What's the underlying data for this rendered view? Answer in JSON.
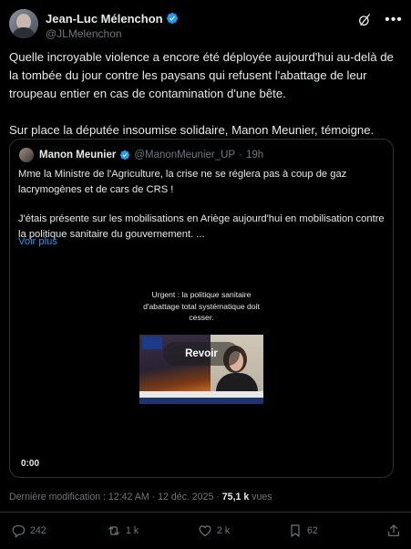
{
  "author": {
    "display_name": "Jean-Luc Mélenchon",
    "handle": "@JLMelenchon",
    "verified_color": "#1d9bf0"
  },
  "header_icons": [
    "grok-icon",
    "more-icon"
  ],
  "tweet": {
    "paragraph_1": "Quelle incroyable violence a encore été déployée aujourd'hui au-delà de la tombée du jour contre les paysans qui refusent l'abattage de leur troupeau entier en cas de contamination d'une bête.",
    "paragraph_2": "Sur place la députée insoumise solidaire, Manon Meunier, témoigne."
  },
  "quote": {
    "display_name": "Manon Meunier",
    "handle": "@ManonMeunier_UP",
    "separator": "·",
    "time": "19h",
    "paragraph_1": "Mme la Ministre de l'Agriculture, la crise ne se réglera pas à coup de gaz lacrymogènes et de cars de CRS !",
    "paragraph_2": "J'étais présente sur les mobilisations en Ariège aujourd'hui en mobilisation contre la politique sanitaire du gouvernement. ...",
    "see_more": "Voir plus",
    "video": {
      "caption": "Urgent : la politique sanitaire d'abattage total systématique doit cesser.",
      "replay_label": "Revoir",
      "timestamp": "0:00"
    }
  },
  "meta": {
    "label": "Dernière modification : 12:42 AM · 12 déc. 2025 · ",
    "views_count": "75,1 k",
    "views_label": " vues"
  },
  "actions": {
    "replies": "242",
    "reposts": "1 k",
    "likes": "2 k",
    "bookmarks": "62"
  },
  "colors": {
    "background": "#000000",
    "text": "#e7e9ea",
    "secondary": "#71767b",
    "accent": "#1d9bf0",
    "border": "#2f3336"
  }
}
